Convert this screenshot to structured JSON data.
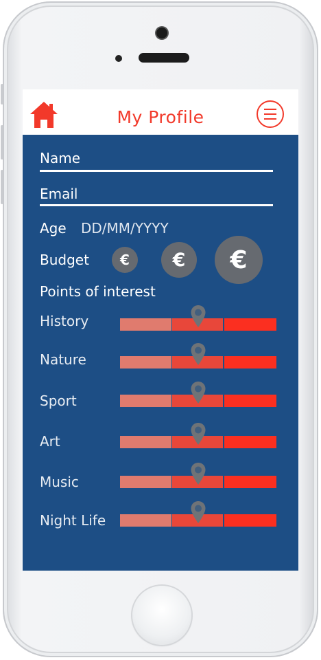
{
  "header": {
    "title": "My Profile",
    "home_icon": "home-icon",
    "menu_icon": "menu-icon"
  },
  "form": {
    "name_placeholder": "Name",
    "email_placeholder": "Email",
    "age_label": "Age",
    "age_placeholder": "DD/MM/YYYY",
    "budget_label": "Budget",
    "budget_levels": [
      {
        "symbol": "€"
      },
      {
        "symbol": "€"
      },
      {
        "symbol": "€"
      }
    ],
    "poi_label": "Points of interest"
  },
  "interests": [
    {
      "label": "History",
      "level": 0.5
    },
    {
      "label": "Nature",
      "level": 0.5
    },
    {
      "label": "Sport",
      "level": 0.5
    },
    {
      "label": "Art",
      "level": 0.5
    },
    {
      "label": "Music",
      "level": 0.5
    },
    {
      "label": "Night Life",
      "level": 0.5
    }
  ],
  "colors": {
    "accent": "#f2392a",
    "panel": "#1d4e85",
    "coin": "#666a70",
    "seg_low": "#e07b6e",
    "seg_mid": "#e8473a",
    "seg_high": "#fb2f20",
    "pin": "#6f7377"
  }
}
